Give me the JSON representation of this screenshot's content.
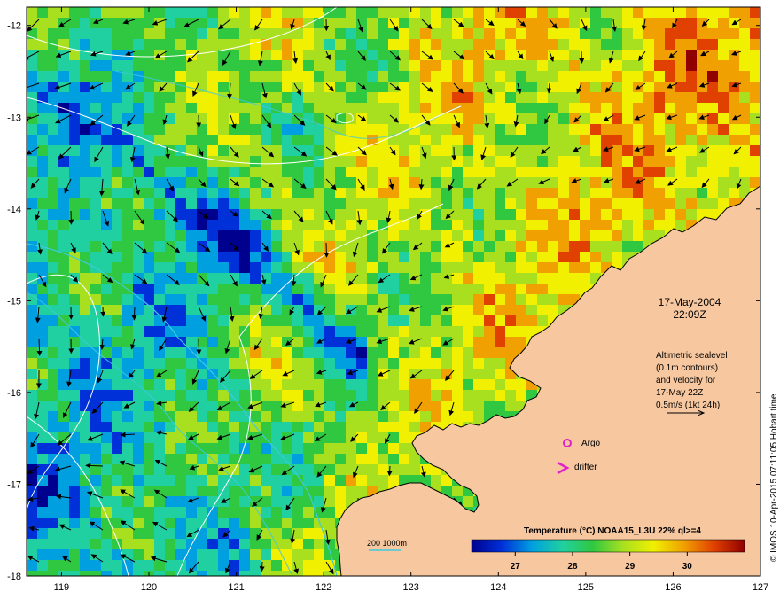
{
  "map": {
    "lat_ticks": [
      "-12",
      "-13",
      "-14",
      "-15",
      "-16",
      "-17",
      "-18"
    ],
    "lon_ticks": [
      "119",
      "120",
      "121",
      "122",
      "123",
      "124",
      "125",
      "126",
      "127"
    ],
    "lon_range": [
      118.6,
      127.0
    ],
    "lat_range": [
      -11.8,
      -18.0
    ]
  },
  "annotations": {
    "date": "17-May-2004",
    "time": "22:09Z",
    "altimetry_lines": [
      "Altimetric sealevel",
      "(0.1m contours)",
      "and velocity for",
      "17-May 22Z",
      "0.5m/s (1kt 24h)"
    ],
    "argo_label": "Argo",
    "drifter_label": "drifter",
    "bathy_label": "200  1000m",
    "credit": "© IMOS 10-Apr-2015 07:11:05 Hobart time"
  },
  "colorbar": {
    "title": "Temperature (°C) NOAA15_L3U 22% ql>=4",
    "ticks": [
      "27",
      "28",
      "29",
      "30"
    ],
    "stops": [
      "#00008f",
      "#0030d8",
      "#00a0e0",
      "#20d0a0",
      "#30c840",
      "#a8e020",
      "#f0f000",
      "#f0a000",
      "#e04000",
      "#900000"
    ]
  },
  "colors": {
    "land": "#f7c8a0",
    "coast": "#000000",
    "contour": "#ffffff",
    "bathy_200": "#40c8e0",
    "argo_marker": "#e020c8",
    "drifter_marker": "#e020c8"
  }
}
